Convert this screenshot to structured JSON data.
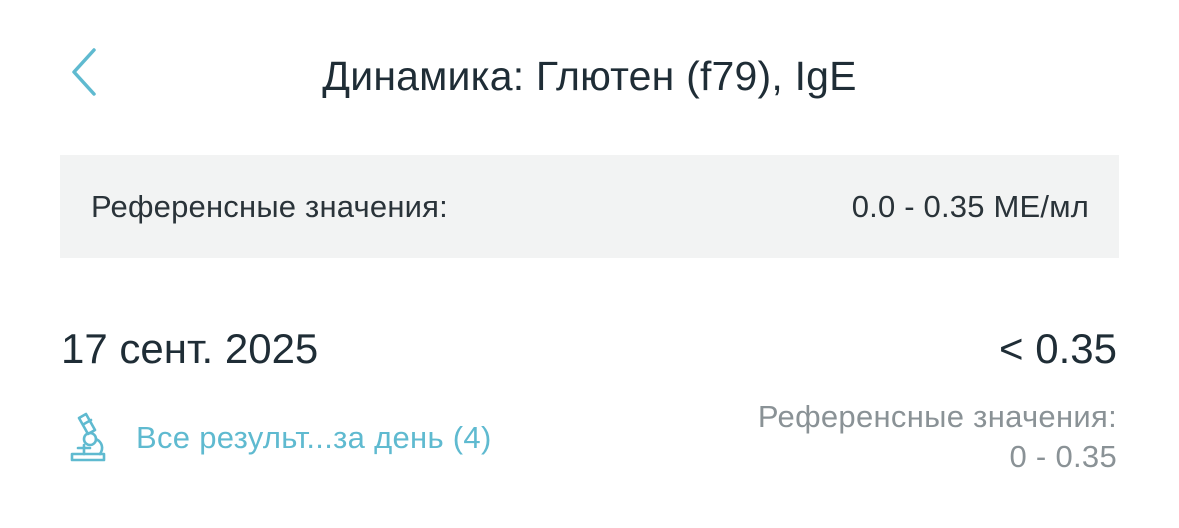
{
  "header": {
    "back_icon": "chevron-left-icon",
    "title": "Динамика: Глютен (f79), IgE"
  },
  "reference_panel": {
    "label": "Референсные значения:",
    "value": "0.0 - 0.35 МЕ/мл"
  },
  "result": {
    "date": "17 сент. 2025",
    "value": "< 0.35",
    "all_results_icon": "microscope-icon",
    "all_results_label": "Все результ...за день (4)",
    "reference_label": "Референсные значения:",
    "reference_value": "0 - 0.35"
  },
  "colors": {
    "accent": "#5fbad0",
    "text_primary": "#1f2d36",
    "text_secondary": "#8a9296",
    "panel_bg": "#f2f3f3"
  }
}
